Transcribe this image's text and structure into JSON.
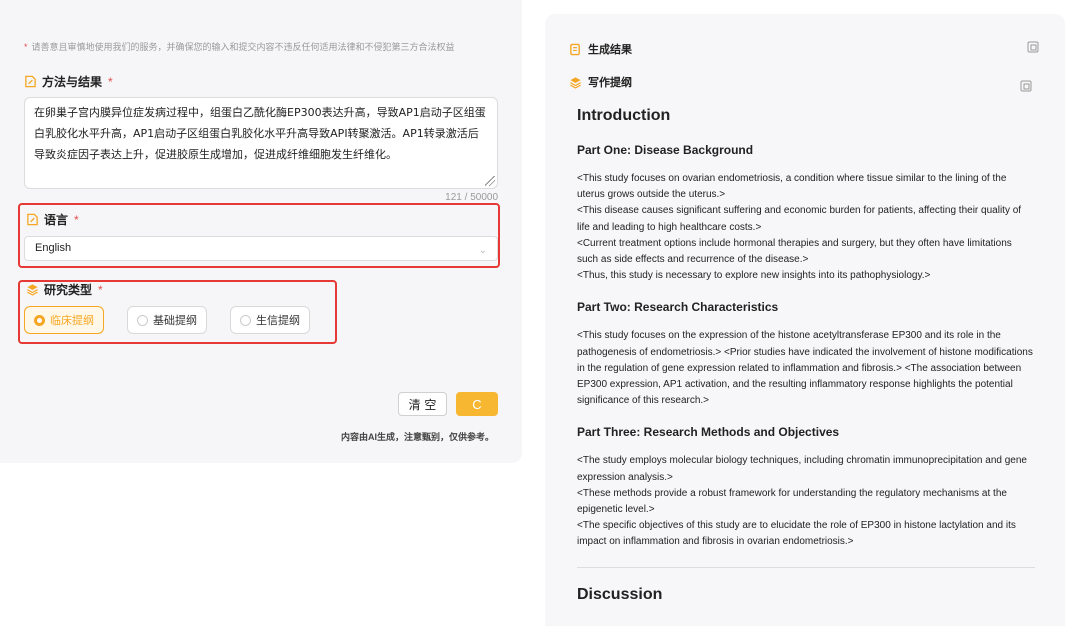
{
  "form": {
    "notice": "请善意且审慎地使用我们的服务，并确保您的输入和提交内容不违反任何适用法律和不侵犯第三方合法权益",
    "notice_star": "*",
    "method_label": "方法与结果",
    "required_mark": "*",
    "method_text": "在卵巢子宫内膜异位症发病过程中，组蛋白乙酰化酶EP300表达升高，导致AP1启动子区组蛋白乳胶化水平升高，AP1启动子区组蛋白乳胶化水平升高导致API转聚激活。AP1转录激活后导致炎症因子表达上升，促进胶原生成增加，促进成纤维细胞发生纤维化。",
    "char_count": "121 / 50000",
    "language_label": "语言",
    "language_value": "English",
    "research_type_label": "研究类型",
    "research_types": [
      "临床提纲",
      "基础提纲",
      "生信提纲"
    ],
    "selected_type": "临床提纲",
    "clear_label": "清 空",
    "generate_icon": "C",
    "disclaimer": "内容由AI生成，注意甄别，仅供参考。"
  },
  "result": {
    "title": "生成结果",
    "subtitle": "写作提纲",
    "intro_heading": "Introduction",
    "part1_heading": "Part One: Disease Background",
    "part1_text": "<This study focuses on ovarian endometriosis, a condition where tissue similar to the lining of the uterus grows outside the uterus.>\n<This disease causes significant suffering and economic burden for patients, affecting their quality of life and leading to high healthcare costs.>\n<Current treatment options include hormonal therapies and surgery, but they often have limitations such as side effects and recurrence of the disease.>\n<Thus, this study is necessary to explore new insights into its pathophysiology.>",
    "part2_heading": "Part Two: Research Characteristics",
    "part2_text": "<This study focuses on the expression of the histone acetyltransferase EP300 and its role in the pathogenesis of endometriosis.> <Prior studies have indicated the involvement of histone modifications in the regulation of gene expression related to inflammation and fibrosis.> <The association between EP300 expression, AP1 activation, and the resulting inflammatory response highlights the potential significance of this research.>",
    "part3_heading": "Part Three: Research Methods and Objectives",
    "part3_text": "<The study employs molecular biology techniques, including chromatin immunoprecipitation and gene expression analysis.>\n<These methods provide a robust framework for understanding the regulatory mechanisms at the epigenetic level.>\n<The specific objectives of this study are to elucidate the role of EP300 in histone lactylation and its impact on inflammation and fibrosis in ovarian endometriosis.>",
    "discussion_heading": "Discussion"
  },
  "colors": {
    "accent": "#f5a623",
    "highlight_box": "#e53935",
    "required": "#e34d4d"
  }
}
